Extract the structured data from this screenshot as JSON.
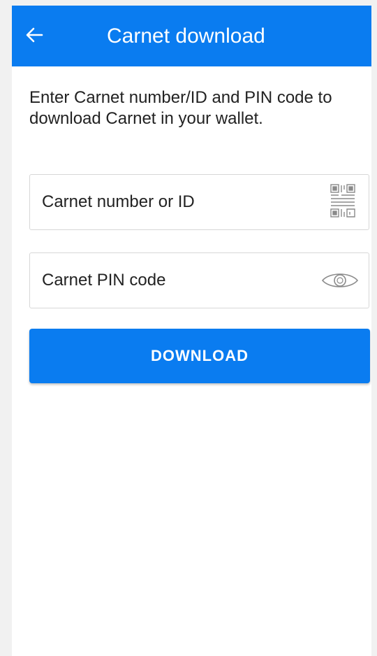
{
  "appbar": {
    "title": "Carnet download",
    "back_icon": "arrow-left-icon"
  },
  "instructions": "Enter Carnet number/ID and PIN code to download Carnet in your wallet.",
  "carnet_number_field": {
    "placeholder": "Carnet number or ID",
    "value": "",
    "icon": "qr-code-scan-icon"
  },
  "pin_field": {
    "placeholder": "Carnet PIN code",
    "value": "",
    "icon": "eye-icon"
  },
  "download_button": {
    "label": "DOWNLOAD"
  },
  "colors": {
    "primary": "#0a7cf0",
    "background": "#f1f1f1",
    "surface": "#ffffff",
    "text": "#222222",
    "border": "#d7d7d7",
    "icon_gray": "#8a8a8a"
  }
}
